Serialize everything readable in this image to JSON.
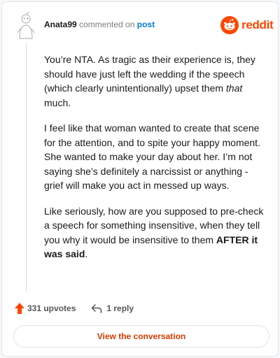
{
  "comment": {
    "username": "Anata99",
    "action": "commented on",
    "post_link": "post",
    "logo_text": "reddit",
    "paragraphs": {
      "p1": {
        "a": "You’re NTA. As tragic as their experience is, they should have just left the wedding if the speech (which clearly unintentionally) upset them ",
        "em": "that",
        "b": " much."
      },
      "p2": "I feel like that woman wanted to create that scene for the attention, and to spite your happy moment. She wanted to make your day about her. I’m not saying she’s definitely a narcissist or anything - grief will make you act in messed up ways.",
      "p3": {
        "a": "Like seriously, how are you supposed to pre-check a speech for something insensitive, when they tell you why it would be insensitive to them ",
        "strong": "AFTER it was said",
        "b": "."
      }
    }
  },
  "footer": {
    "upvotes": "331 upvotes",
    "replies": "1 reply"
  },
  "cta": {
    "label": "View the conversation"
  },
  "colors": {
    "brand": "#ff4500",
    "link": "#0079d3",
    "cta_text": "#d93a00"
  },
  "icons": {
    "upvote": "upvote-arrow-icon",
    "reply": "reply-arrow-icon",
    "logo": "reddit-snoo-icon"
  }
}
